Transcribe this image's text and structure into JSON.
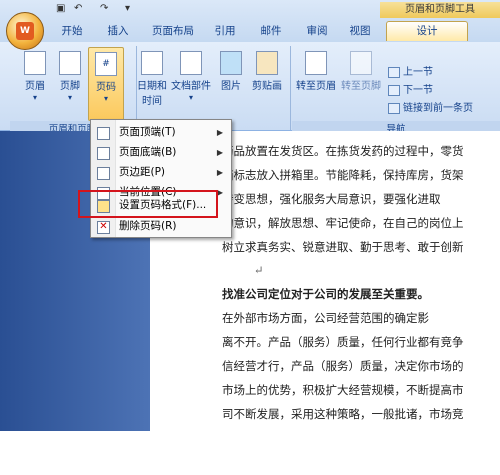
{
  "window": {
    "tool_title": "页眉和页脚工具"
  },
  "quick_access": {
    "save": "▣",
    "undo": "↶",
    "redo": "↷",
    "more": "▾"
  },
  "tabs": [
    "开始",
    "插入",
    "页面布局",
    "引用",
    "邮件",
    "审阅",
    "视图",
    "设计"
  ],
  "ribbon": {
    "group1": {
      "buttons": [
        "页眉",
        "页脚",
        "页码"
      ],
      "label": "页眉和页脚"
    },
    "group2": {
      "buttons": [
        "日期和\n时间",
        "文档部件",
        "图片",
        "剪贴画"
      ]
    },
    "group3": {
      "buttons": [
        "转至页眉",
        "转至页脚"
      ],
      "small": [
        "上一节",
        "下一节",
        "链接到前一条页"
      ],
      "label": "导航"
    }
  },
  "menu": {
    "items": [
      {
        "label": "页面顶端(T)",
        "submenu": true
      },
      {
        "label": "页面底端(B)",
        "submenu": true
      },
      {
        "label": "页边距(P)",
        "submenu": true
      },
      {
        "label": "当前位置(C)",
        "submenu": true
      },
      {
        "label": "设置页码格式(F)...",
        "submenu": false
      },
      {
        "label": "删除页码(R)",
        "submenu": false
      }
    ]
  },
  "document": {
    "lines": [
      "药品放置在发货区。在拣货发药的过程中，零货",
      "箱标志放入拼箱里。节能降耗，保持库房，货架",
      "    转变思想，强化服务大局意识，要强化进取",
      "的意识，解放思想、牢记使命，在自己的岗位上",
      "树立求真务实、锐意进取、勤于思考、敢于创新",
      "↵",
      "    找准公司定位对于公司的发展至关重要。",
      "    在外部市场方面，公司经营范围的确定影",
      "离不开。产品（服务）质量，任何行业都有竞争",
      "信经营才行，产品（服务）质量，决定你市场的",
      "市场上的优势，积极扩大经营规模，不断提高市",
      "司不断发展，采用这种策略，一般批诸，市场竞"
    ]
  },
  "colors": {
    "accent": "#d4141c",
    "ribbon": "#cadcf3",
    "sidebar": "#3a60a4"
  }
}
